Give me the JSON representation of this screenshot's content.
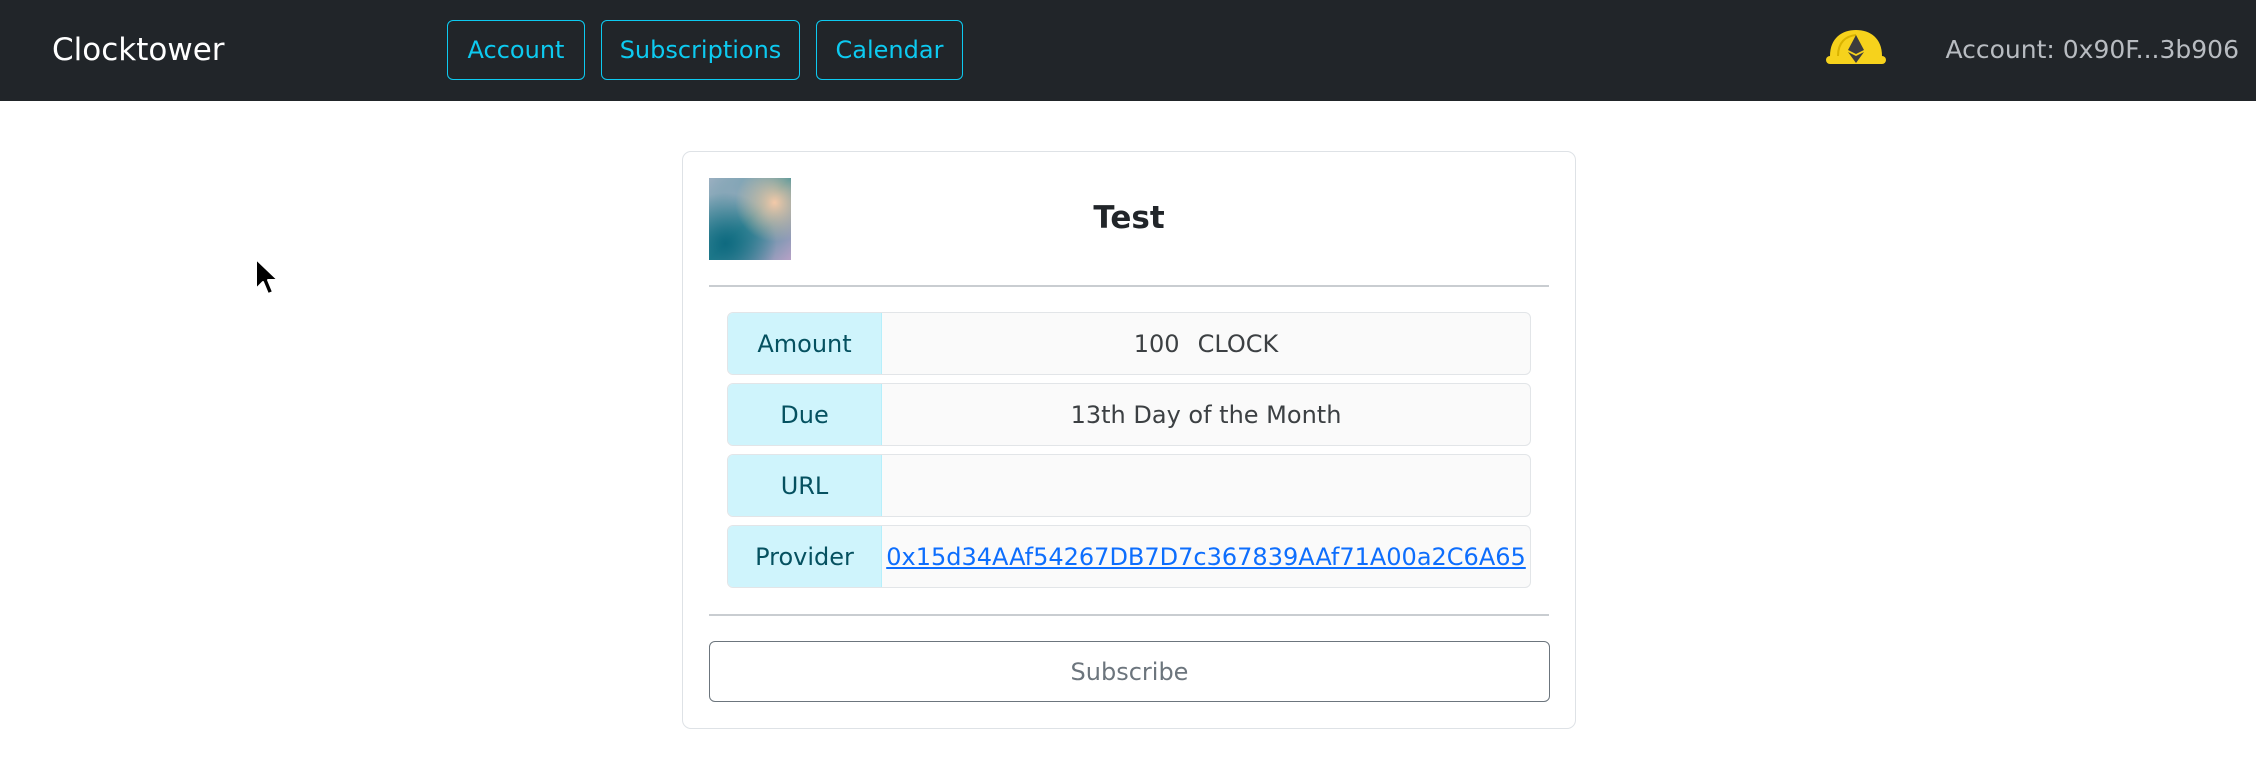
{
  "navbar": {
    "brand": "Clocktower",
    "links": [
      "Account",
      "Subscriptions",
      "Calendar"
    ],
    "wallet_icon": "metamask-fox-icon",
    "account_label": "Account: 0x90F...3b906"
  },
  "subscription": {
    "title": "Test",
    "rows": [
      {
        "label": "Amount",
        "value": "100",
        "unit": "CLOCK"
      },
      {
        "label": "Due",
        "value": "13th Day of the Month"
      },
      {
        "label": "URL",
        "value": ""
      },
      {
        "label": "Provider",
        "value": "0x15d34AAf54267DB7D7c367839AAf71A00a2C6A65"
      }
    ],
    "subscribe_label": "Subscribe"
  },
  "colors": {
    "navbar_bg": "#212529",
    "accent": "#0dcaf0",
    "label_bg": "#cff4fc",
    "link": "#0d6efd"
  }
}
